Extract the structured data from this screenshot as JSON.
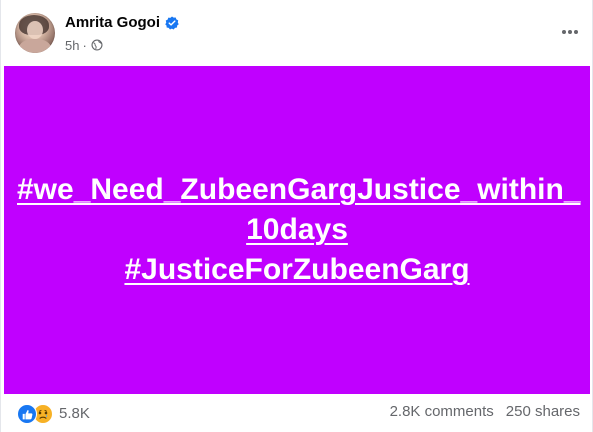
{
  "post": {
    "author": {
      "name": "Amrita Gogoi",
      "verified": true
    },
    "timestamp": "5h",
    "separator": "·",
    "privacy_icon": "globe-icon",
    "more_icon": "more-options-icon",
    "content": {
      "background_color": "#c000ff",
      "text_color": "#ffffff",
      "lines": [
        "#we_Need_ZubeenGargJustice_within_",
        "10days",
        "#JusticeForZubeenGarg"
      ]
    },
    "stats": {
      "reactions": [
        "like-icon",
        "sad-icon"
      ],
      "reaction_count": "5.8K",
      "comments": "2.8K comments",
      "shares": "250 shares"
    }
  },
  "colors": {
    "accent": "#1877f2",
    "secondary_text": "#65676b",
    "post_background": "#c000ff"
  }
}
